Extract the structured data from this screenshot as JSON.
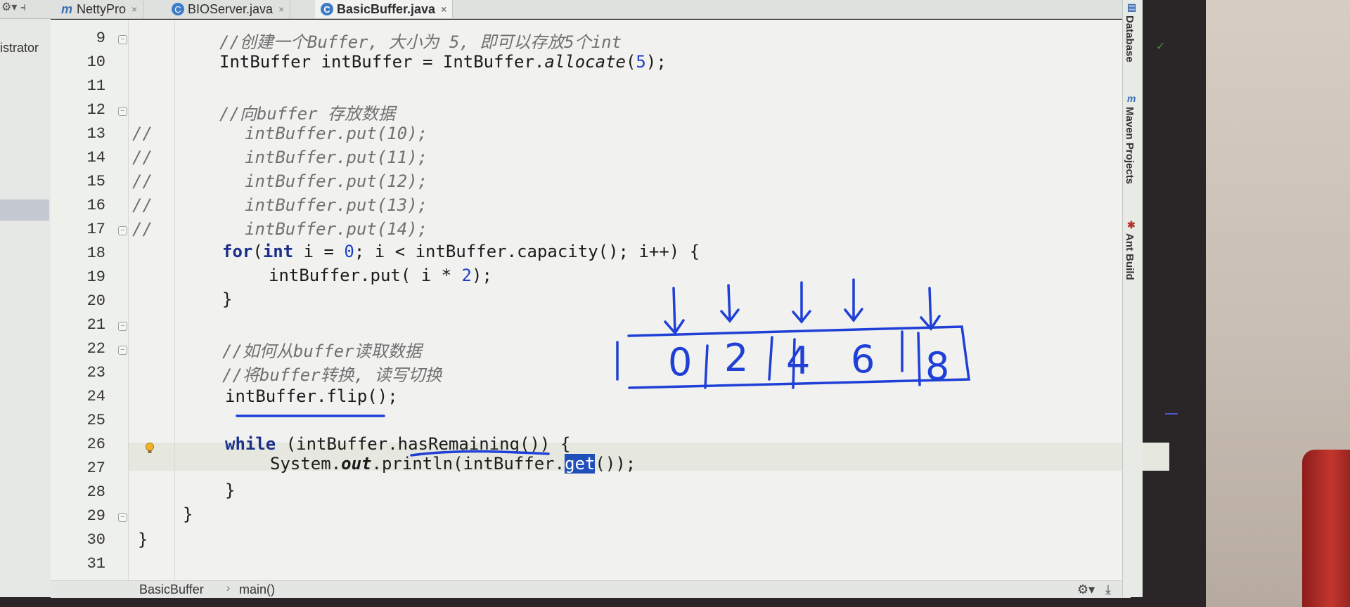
{
  "tabs": [
    {
      "label": "NettyPro",
      "icon": "module-icon",
      "active": false
    },
    {
      "label": "BIOServer.java",
      "icon": "class-icon",
      "active": false
    },
    {
      "label": "BasicBuffer.java",
      "icon": "class-icon",
      "active": true
    }
  ],
  "tab_close_glyph": "×",
  "project_panel": {
    "label": "istrator"
  },
  "code_lines": [
    {
      "num": "9"
    },
    {
      "num": "10"
    },
    {
      "num": "11"
    },
    {
      "num": "12"
    },
    {
      "num": "13"
    },
    {
      "num": "14"
    },
    {
      "num": "15"
    },
    {
      "num": "16"
    },
    {
      "num": "17"
    },
    {
      "num": "18"
    },
    {
      "num": "19"
    },
    {
      "num": "20"
    },
    {
      "num": "21"
    },
    {
      "num": "22"
    },
    {
      "num": "23"
    },
    {
      "num": "24"
    },
    {
      "num": "25"
    },
    {
      "num": "26"
    },
    {
      "num": "27"
    },
    {
      "num": "28"
    },
    {
      "num": "29"
    },
    {
      "num": "30"
    },
    {
      "num": "31"
    }
  ],
  "code": {
    "l9": "//创建一个Buffer, 大小为 5, 即可以存放5个int",
    "l10a": "IntBuffer intBuffer = IntBuffer.",
    "l10b": "allocate",
    "l10c": "(",
    "l10d": "5",
    "l10e": ");",
    "l12": "//向buffer 存放数据",
    "l13a": "//",
    "l13b": "intBuffer.put(10);",
    "l14b": "intBuffer.put(11);",
    "l15b": "intBuffer.put(12);",
    "l16b": "intBuffer.put(13);",
    "l17b": "intBuffer.put(14);",
    "l18a": "for",
    "l18b": "(",
    "l18c": "int",
    "l18d": " i = ",
    "l18e": "0",
    "l18f": "; i < intBuffer.capacity(); i++) {",
    "l19a": "intBuffer.put( i * ",
    "l19b": "2",
    "l19c": ");",
    "l20": "}",
    "l22": "//如何从buffer读取数据",
    "l23": "//将buffer转换, 读写切换",
    "l24": "intBuffer.flip();",
    "l26a": "while",
    "l26b": " (intBuffer.hasRemaining()) {",
    "l27a": "System.",
    "l27b": "out",
    "l27c": ".println(intBuffer.",
    "l27d": "get",
    "l27e": "());",
    "l28": "}",
    "l29": "}",
    "l30": "}"
  },
  "annotation": {
    "values": [
      "0",
      "2",
      "4",
      "6",
      "8"
    ],
    "left_mark": "|",
    "color": "#1f3fd6"
  },
  "breadcrumb": {
    "file": "BasicBuffer",
    "sep": "›",
    "method": "main()"
  },
  "right_tools": [
    {
      "label": "Database",
      "icon": "database-icon"
    },
    {
      "label": "Maven Projects",
      "icon": "maven-icon"
    },
    {
      "label": "Ant Build",
      "icon": "ant-icon"
    }
  ],
  "colors": {
    "keyword": "#1c2f8a",
    "number": "#1e40c8",
    "comment": "#707070",
    "selection": "#1f4fb8",
    "ink": "#1f3fd6"
  }
}
